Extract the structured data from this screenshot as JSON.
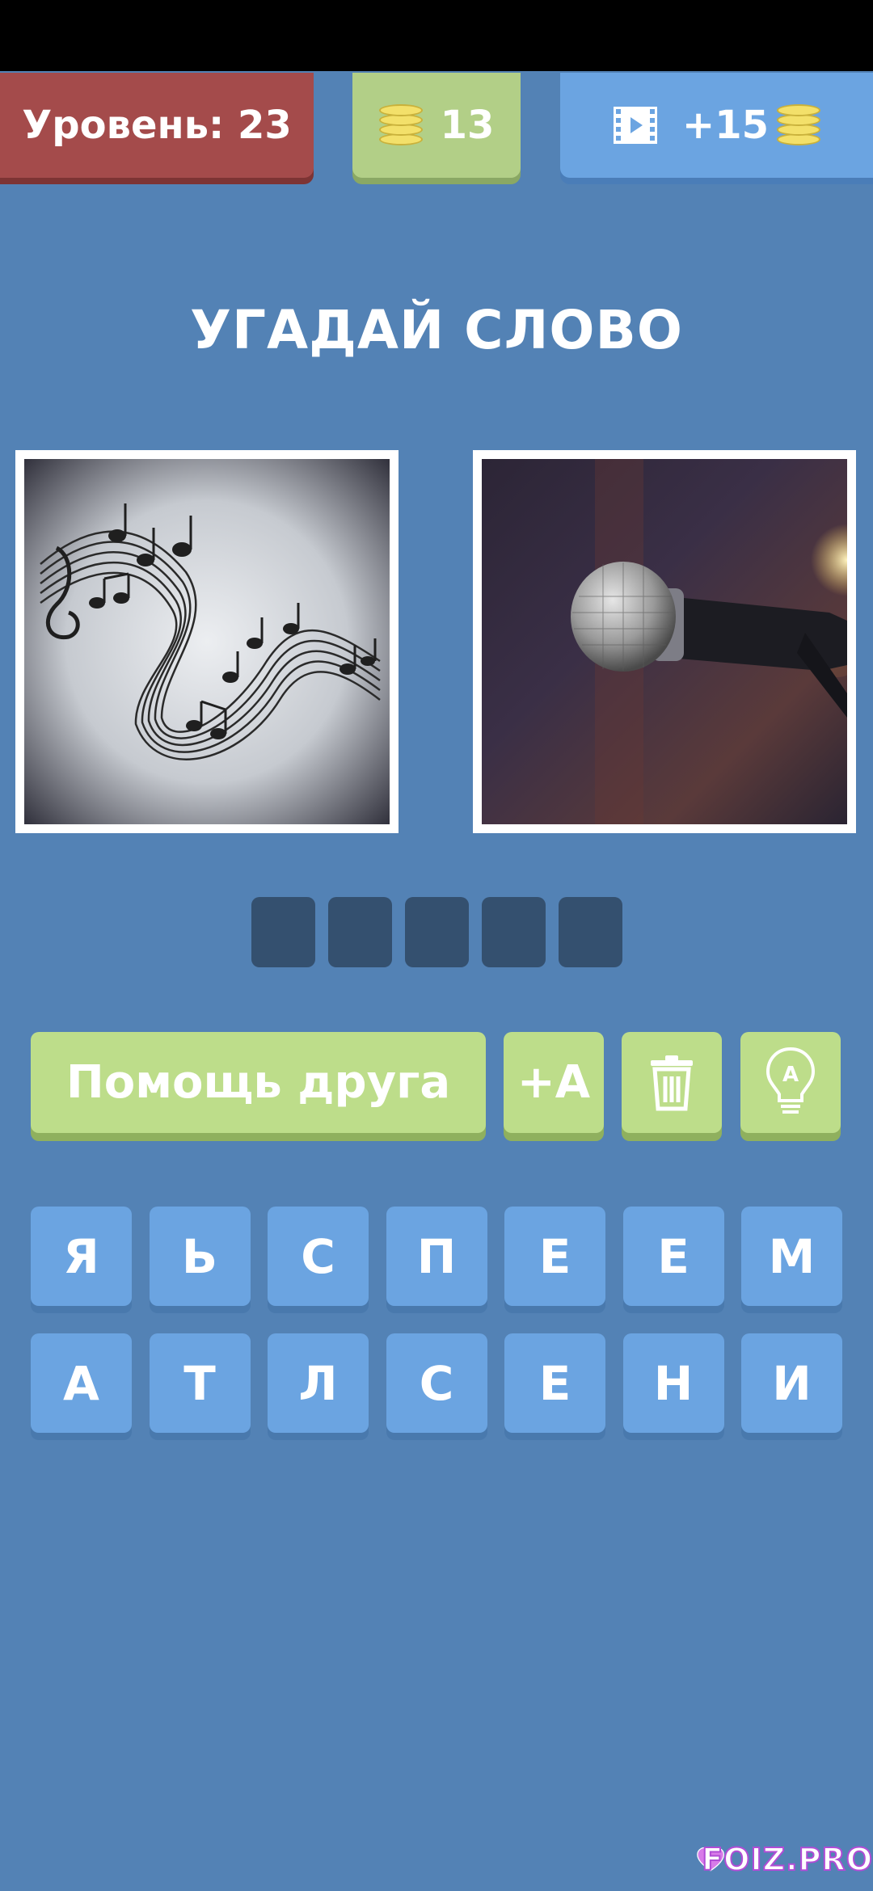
{
  "header": {
    "level_label": "Уровень: 23",
    "coins": "13",
    "video_reward": "+15"
  },
  "title": "УГАДАЙ СЛОВО",
  "images": [
    {
      "icon": "music-notes-image"
    },
    {
      "icon": "microphone-image"
    }
  ],
  "answer_slots": [
    "",
    "",
    "",
    "",
    ""
  ],
  "actions": {
    "friend_help_label": "Помощь друга",
    "add_letter_label": "+A",
    "remove_icon": "trash-icon",
    "hint_icon": "lightbulb-icon"
  },
  "keyboard": {
    "row1": [
      "Я",
      "Ь",
      "С",
      "П",
      "Е",
      "Е",
      "М"
    ],
    "row2": [
      "А",
      "Т",
      "Л",
      "С",
      "Е",
      "Н",
      "И"
    ]
  },
  "watermark": {
    "text": "FOIZ.PRO"
  },
  "colors": {
    "background": "#5382b5",
    "level": "#a44b4b",
    "coins": "#b2cf87",
    "video": "#6ba4e1",
    "key": "#6ba4e1",
    "action": "#bddd8a",
    "slot": "#34506f"
  }
}
